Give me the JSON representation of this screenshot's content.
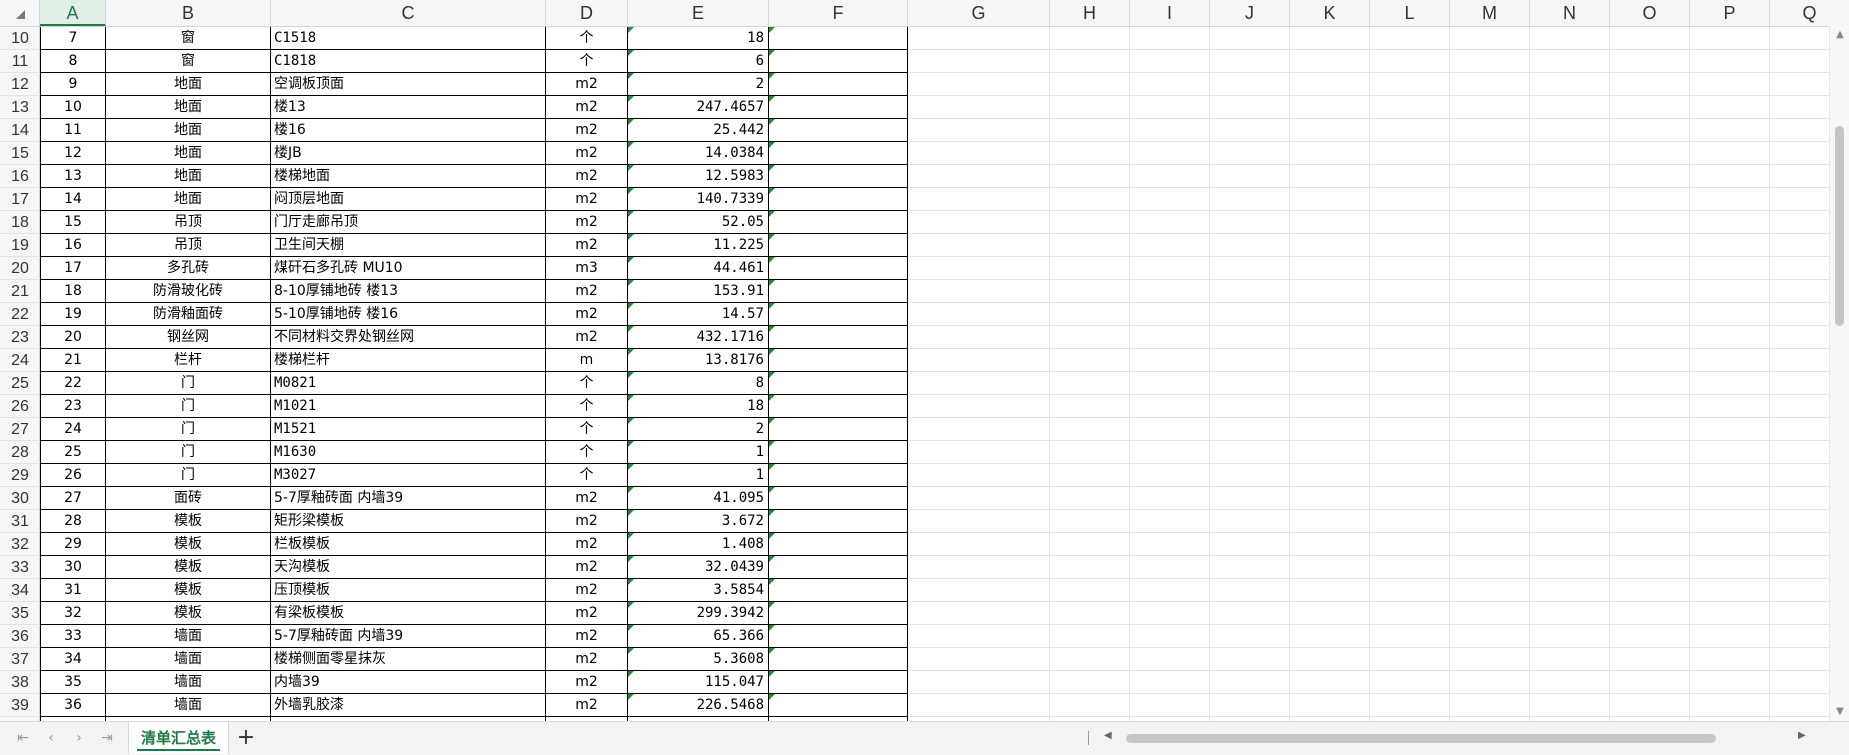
{
  "columns": [
    "A",
    "B",
    "C",
    "D",
    "E",
    "F",
    "G",
    "H",
    "I",
    "J",
    "K",
    "L",
    "M",
    "N",
    "O",
    "P",
    "Q"
  ],
  "active_column": "A",
  "rows": [
    {
      "row": "10",
      "a": "7",
      "b": "窗",
      "c": "C1518",
      "d": "个",
      "e": "18"
    },
    {
      "row": "11",
      "a": "8",
      "b": "窗",
      "c": "C1818",
      "d": "个",
      "e": "6"
    },
    {
      "row": "12",
      "a": "9",
      "b": "地面",
      "c": "空调板顶面",
      "d": "m2",
      "e": "2"
    },
    {
      "row": "13",
      "a": "10",
      "b": "地面",
      "c": "楼13",
      "d": "m2",
      "e": "247.4657"
    },
    {
      "row": "14",
      "a": "11",
      "b": "地面",
      "c": "楼16",
      "d": "m2",
      "e": "25.442"
    },
    {
      "row": "15",
      "a": "12",
      "b": "地面",
      "c": "楼JB",
      "d": "m2",
      "e": "14.0384"
    },
    {
      "row": "16",
      "a": "13",
      "b": "地面",
      "c": "楼梯地面",
      "d": "m2",
      "e": "12.5983"
    },
    {
      "row": "17",
      "a": "14",
      "b": "地面",
      "c": "闷顶层地面",
      "d": "m2",
      "e": "140.7339"
    },
    {
      "row": "18",
      "a": "15",
      "b": "吊顶",
      "c": "门厅走廊吊顶",
      "d": "m2",
      "e": "52.05"
    },
    {
      "row": "19",
      "a": "16",
      "b": "吊顶",
      "c": "卫生间天棚",
      "d": "m2",
      "e": "11.225"
    },
    {
      "row": "20",
      "a": "17",
      "b": "多孔砖",
      "c": "煤矸石多孔砖 MU10",
      "d": "m3",
      "e": "44.461"
    },
    {
      "row": "21",
      "a": "18",
      "b": "防滑玻化砖",
      "c": "8-10厚铺地砖 楼13",
      "d": "m2",
      "e": "153.91"
    },
    {
      "row": "22",
      "a": "19",
      "b": "防滑釉面砖",
      "c": "5-10厚铺地砖 楼16",
      "d": "m2",
      "e": "14.57"
    },
    {
      "row": "23",
      "a": "20",
      "b": "钢丝网",
      "c": "不同材料交界处钢丝网",
      "d": "m2",
      "e": "432.1716"
    },
    {
      "row": "24",
      "a": "21",
      "b": "栏杆",
      "c": "楼梯栏杆",
      "d": "m",
      "e": "13.8176"
    },
    {
      "row": "25",
      "a": "22",
      "b": "门",
      "c": "M0821",
      "d": "个",
      "e": "8"
    },
    {
      "row": "26",
      "a": "23",
      "b": "门",
      "c": "M1021",
      "d": "个",
      "e": "18"
    },
    {
      "row": "27",
      "a": "24",
      "b": "门",
      "c": "M1521",
      "d": "个",
      "e": "2"
    },
    {
      "row": "28",
      "a": "25",
      "b": "门",
      "c": "M1630",
      "d": "个",
      "e": "1"
    },
    {
      "row": "29",
      "a": "26",
      "b": "门",
      "c": "M3027",
      "d": "个",
      "e": "1"
    },
    {
      "row": "30",
      "a": "27",
      "b": "面砖",
      "c": "5-7厚釉砖面 内墙39",
      "d": "m2",
      "e": "41.095"
    },
    {
      "row": "31",
      "a": "28",
      "b": "模板",
      "c": "矩形梁模板",
      "d": "m2",
      "e": "3.672"
    },
    {
      "row": "32",
      "a": "29",
      "b": "模板",
      "c": "栏板模板",
      "d": "m2",
      "e": "1.408"
    },
    {
      "row": "33",
      "a": "30",
      "b": "模板",
      "c": "天沟模板",
      "d": "m2",
      "e": "32.0439"
    },
    {
      "row": "34",
      "a": "31",
      "b": "模板",
      "c": "压顶模板",
      "d": "m2",
      "e": "3.5854"
    },
    {
      "row": "35",
      "a": "32",
      "b": "模板",
      "c": "有梁板模板",
      "d": "m2",
      "e": "299.3942"
    },
    {
      "row": "36",
      "a": "33",
      "b": "墙面",
      "c": "5-7厚釉砖面 内墙39",
      "d": "m2",
      "e": "65.366"
    },
    {
      "row": "37",
      "a": "34",
      "b": "墙面",
      "c": "楼梯侧面零星抹灰",
      "d": "m2",
      "e": "5.3608"
    },
    {
      "row": "38",
      "a": "35",
      "b": "墙面",
      "c": "内墙39",
      "d": "m2",
      "e": "115.047"
    },
    {
      "row": "39",
      "a": "36",
      "b": "墙面",
      "c": "外墙乳胶漆",
      "d": "m2",
      "e": "226.5468"
    }
  ],
  "sheet_tabs": [
    {
      "label": "清单汇总表",
      "active": true
    }
  ],
  "nav": {
    "first": "⇤",
    "prev": "‹",
    "next": "›",
    "last": "⇥",
    "add": "+"
  },
  "icons": {
    "first": "first-sheet-icon",
    "prev": "prev-sheet-icon",
    "next": "next-sheet-icon",
    "last": "last-sheet-icon",
    "add": "add-sheet-icon"
  },
  "colors": {
    "accent": "#1f7a45",
    "header_bg": "#f5f6f7",
    "green_marker": "#1f8a3a"
  }
}
